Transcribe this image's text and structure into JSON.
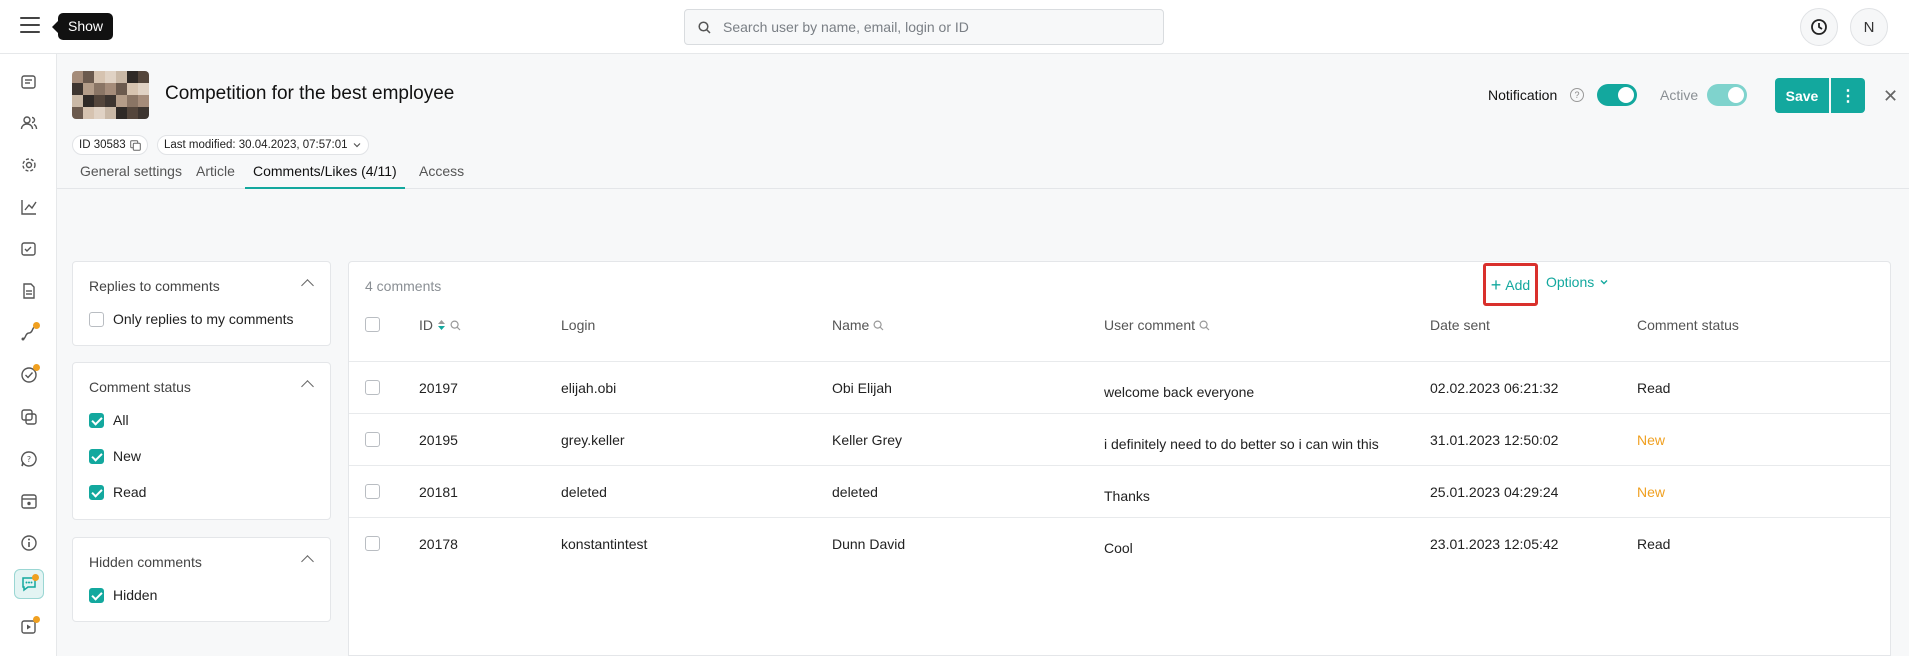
{
  "header": {
    "tooltip": "Show",
    "search_placeholder": "Search user by name, email, login or ID",
    "avatar_initial": "N"
  },
  "page": {
    "title": "Competition for the best employee",
    "id_chip": "ID 30583",
    "modified_chip": "Last modified: 30.04.2023, 07:57:01",
    "notification_label": "Notification",
    "active_label": "Active",
    "save_label": "Save"
  },
  "tabs": [
    {
      "label": "General settings"
    },
    {
      "label": "Article"
    },
    {
      "label": "Comments/Likes (4/11)"
    },
    {
      "label": "Access"
    }
  ],
  "filters": {
    "replies": {
      "title": "Replies to comments",
      "only_mine": "Only replies to my comments"
    },
    "status": {
      "title": "Comment status",
      "all": "All",
      "new": "New",
      "read": "Read"
    },
    "hidden": {
      "title": "Hidden comments",
      "hidden": "Hidden"
    }
  },
  "table": {
    "count": "4 comments",
    "add_label": "Add",
    "options_label": "Options",
    "columns": {
      "id": "ID",
      "login": "Login",
      "name": "Name",
      "comment": "User comment",
      "date": "Date sent",
      "status": "Comment status"
    },
    "rows": [
      {
        "id": "20197",
        "login": "elijah.obi",
        "name": "Obi Elijah",
        "comment": "welcome back everyone",
        "date": "02.02.2023 06:21:32",
        "status": "Read"
      },
      {
        "id": "20195",
        "login": "grey.keller",
        "name": "Keller Grey",
        "comment": "i definitely need to do better so i can win this",
        "date": "31.01.2023 12:50:02",
        "status": "New"
      },
      {
        "id": "20181",
        "login": "deleted",
        "name": "deleted",
        "comment": "Thanks",
        "date": "25.01.2023 04:29:24",
        "status": "New"
      },
      {
        "id": "20178",
        "login": "konstantintest",
        "name": "Dunn David",
        "comment": "Cool",
        "date": "23.01.2023 12:05:42",
        "status": "Read"
      }
    ]
  },
  "colors": {
    "accent": "#13a89e",
    "new_status": "#f0a020",
    "highlight": "#d9302c"
  }
}
